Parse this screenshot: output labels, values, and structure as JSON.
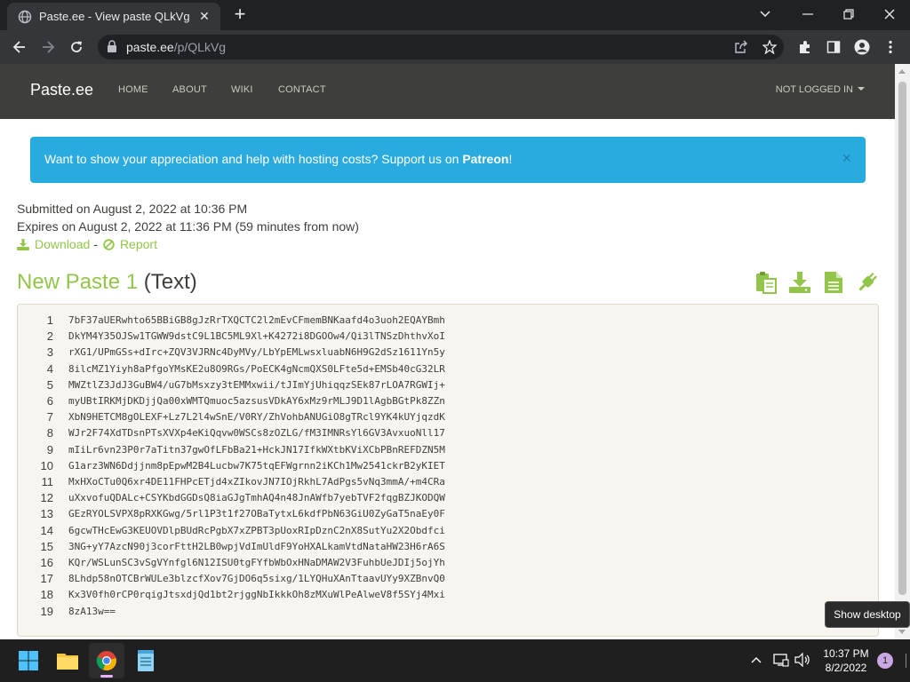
{
  "browser": {
    "tab_title": "Paste.ee - View paste QLkVg",
    "tab_close": "✕",
    "new_tab": "+",
    "url_host": "paste.ee",
    "url_path": "/p/QLkVg"
  },
  "nav": {
    "brand": "Paste.ee",
    "links": [
      "HOME",
      "ABOUT",
      "WIKI",
      "CONTACT"
    ],
    "user": "NOT LOGGED IN"
  },
  "alert": {
    "text": "Want to show your appreciation and help with hosting costs? Support us on ",
    "link": "Patreon",
    "suffix": "!",
    "close": "×"
  },
  "meta": {
    "submitted": "Submitted on August 2, 2022 at 10:36 PM",
    "expires": "Expires on August 2, 2022 at 11:36 PM (59 minutes from now)",
    "download": "Download",
    "separator": "-",
    "report": "Report"
  },
  "paste": {
    "name": "New Paste 1",
    "language": "(Text)",
    "lines": [
      "7bF37aUERwhto65BBiGB8gJzRrTXQCTC2l2mEvCFmemBNKaafd4o3uoh2EQAYBmh",
      "DkYM4Y35OJSw1TGWW9dstC9L1BC5ML9Xl+K4272i8DGOOw4/Qi3lTNSzDhthvXoI",
      "rXG1/UPmGSs+dIrc+ZQV3VJRNc4DyMVy/LbYpEMLwsxluabN6H9G2dSz1611Yn5y",
      "8ilcMZ1Yiyh8aPfgoYMsKE2u8O9RGs/PoECK4gNcmQXS0LFte5d+EMSb40cG32LR",
      "MWZtlZ3JdJ3GuBW4/uG7bMsxzy3tEMMxwii/tJImYjUhiqqzSEk87rLOA7RGWIj+",
      "myUBtIRKMjDKDjjQa00xWMTQmuoc5azsusVDkAY6xMz9rMLJ9D1lAgbBGtPk8ZZn",
      "XbN9HETCM8gOLEXF+Lz7L2l4wSnE/V0RY/ZhVohbANUGiO8gTRcl9YK4kUYjqzdK",
      "WJr2F74XdTDsnPTsXVXp4eKiQqvw0WSCs8zOZLG/fM3IMNRsYl6GV3AvxuoNll17",
      "mIiLr6vn23P0r7aTitn37gwOfLFbBa21+HckJN17IfkWXtbKViXCbPBnREFDZN5M",
      "G1arz3WN6Ddjjnm8pEpwM2B4Lucbw7K75tqEFWgrnn2iKCh1Mw2541ckrB2yKIET",
      "MxHXoCTu0Q6xr4DE11FHPcETjd4xZIkovJN7IOjRkhL7AdPgs5vNq3mmA/+m4CRa",
      "uXxvofuQDALc+CSYKbdGGDsQ8iaGJgTmhAQ4n48JnAWfb7yebTVF2fqgBZJKODQW",
      "GEzRYOLSVPX8pRXKGwg/5rl1P3t1f27OBaTytxL6kdfPbN63GiU0ZyGaT5naEy0F",
      "6gcwTHcEwG3KEUOVDlpBUdRcPgbX7xZPBT3pUoxRIpDznC2nX8SutYu2X2Obdfci",
      "3NG+yY7AzcN90j3corFttH2LB0wpjVdImUldF9YoHXALkamVtdNataHW23H6rA6S",
      "KQr/WSLunSC3vSgVYnfgl6N12ISU0tgFYfbWbOxHNaDMAW2V3FuhbUeJDIj5ojYh",
      "8Lhdp58nOTCBrWULe3blzcfXov7GjDO6q5sixg/1LYQHuXAnTtaavUYy9XZBnvQ0",
      "Kx3V0fh0rCP0rqigJtsxdjQd1bt2rjggNbIkkkOh8zMXuWlPeAlweV8f5SYj4Mxi",
      "8zA13w=="
    ]
  },
  "taskbar": {
    "time": "10:37 PM",
    "date": "8/2/2022",
    "notifications": "1",
    "tooltip": "Show desktop"
  },
  "colors": {
    "accent_green": "#93c54b",
    "alert_blue": "#29abe0",
    "navbar": "#3e3f3a"
  }
}
